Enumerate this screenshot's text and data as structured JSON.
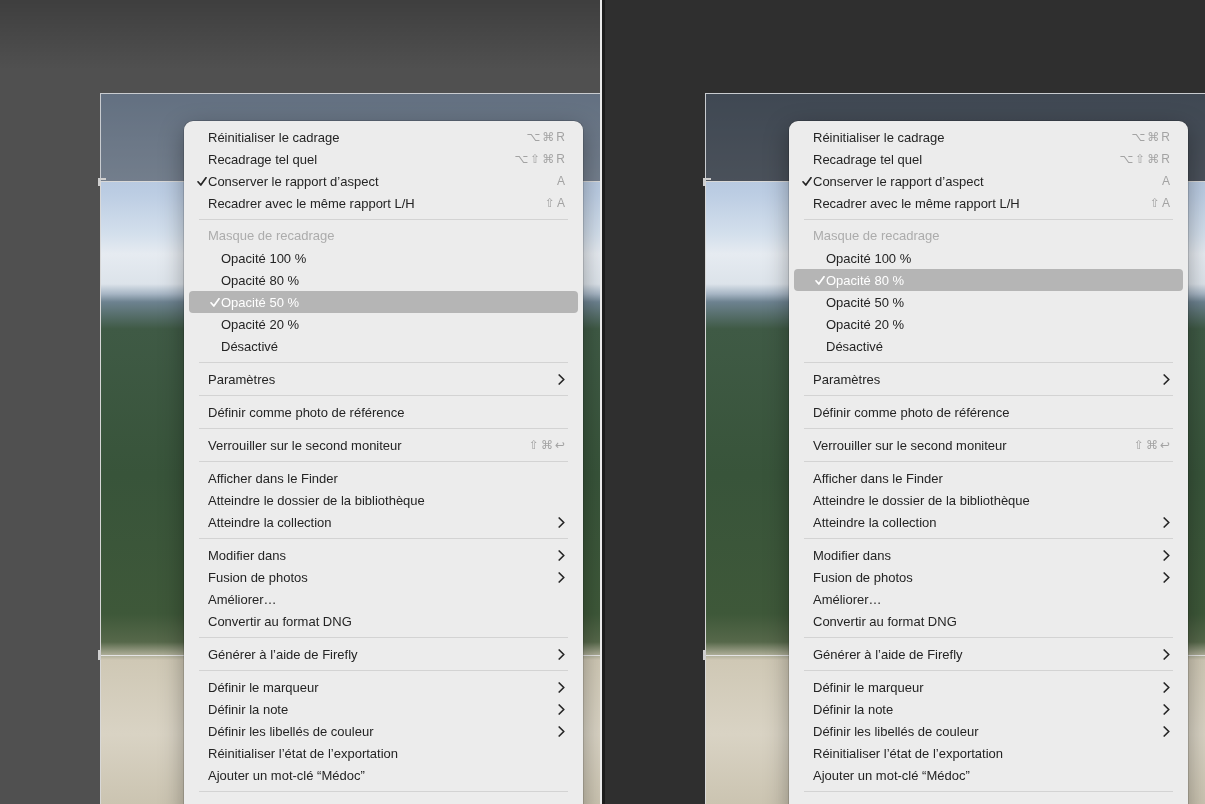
{
  "panels": [
    {
      "color": "#505050",
      "menu": {
        "sections": [
          {
            "items": [
              {
                "label": "Réinitialiser le cadrage",
                "shortcut": "⌥⌘R",
                "checked": false,
                "highlighted": false
              },
              {
                "label": "Recadrage tel quel",
                "shortcut": "⌥⇧⌘R",
                "checked": false,
                "highlighted": false
              },
              {
                "label": "Conserver le rapport d’aspect",
                "shortcut": "A",
                "checked": true,
                "highlighted": false
              },
              {
                "label": "Recadrer avec le même rapport L/H",
                "shortcut": "⇧A",
                "checked": false,
                "highlighted": false
              }
            ]
          },
          {
            "header": "Masque de recadrage",
            "items": [
              {
                "label": "Opacité 100 %",
                "selected": false,
                "highlighted": false
              },
              {
                "label": "Opacité 80 %",
                "selected": false,
                "highlighted": false
              },
              {
                "label": "Opacité 50 %",
                "selected": true,
                "highlighted": true
              },
              {
                "label": "Opacité 20 %",
                "selected": false,
                "highlighted": false
              },
              {
                "label": "Désactivé",
                "selected": false,
                "highlighted": false
              }
            ]
          },
          {
            "items": [
              {
                "label": "Paramètres",
                "submenu": true,
                "highlighted": false
              }
            ]
          },
          {
            "items": [
              {
                "label": "Définir comme photo de référence",
                "highlighted": false
              }
            ]
          },
          {
            "items": [
              {
                "label": "Verrouiller sur le second moniteur",
                "shortcut": "⇧⌘↩",
                "highlighted": false
              }
            ]
          },
          {
            "items": [
              {
                "label": "Afficher dans le Finder",
                "highlighted": false
              },
              {
                "label": "Atteindre le dossier de la bibliothèque",
                "highlighted": false
              },
              {
                "label": "Atteindre la collection",
                "submenu": true,
                "highlighted": false
              }
            ]
          },
          {
            "items": [
              {
                "label": "Modifier dans",
                "submenu": true,
                "highlighted": false
              },
              {
                "label": "Fusion de photos",
                "submenu": true,
                "highlighted": false
              },
              {
                "label": "Améliorer…",
                "highlighted": false
              },
              {
                "label": "Convertir au format DNG",
                "highlighted": false
              }
            ]
          },
          {
            "items": [
              {
                "label": "Générer à l’aide de Firefly",
                "submenu": true,
                "highlighted": false
              }
            ]
          },
          {
            "items": [
              {
                "label": "Définir le marqueur",
                "submenu": true,
                "highlighted": false
              },
              {
                "label": "Définir la note",
                "submenu": true,
                "highlighted": false
              },
              {
                "label": "Définir les libellés de couleur",
                "submenu": true,
                "highlighted": false
              },
              {
                "label": "Réinitialiser l’état de l’exportation",
                "highlighted": false
              },
              {
                "label": "Ajouter un mot-clé “Médoc”",
                "highlighted": false
              }
            ]
          }
        ]
      }
    },
    {
      "color": "#2f2f2f",
      "menu": {
        "sections": [
          {
            "items": [
              {
                "label": "Réinitialiser le cadrage",
                "shortcut": "⌥⌘R",
                "checked": false,
                "highlighted": false
              },
              {
                "label": "Recadrage tel quel",
                "shortcut": "⌥⇧⌘R",
                "checked": false,
                "highlighted": false
              },
              {
                "label": "Conserver le rapport d’aspect",
                "shortcut": "A",
                "checked": true,
                "highlighted": false
              },
              {
                "label": "Recadrer avec le même rapport L/H",
                "shortcut": "⇧A",
                "checked": false,
                "highlighted": false
              }
            ]
          },
          {
            "header": "Masque de recadrage",
            "items": [
              {
                "label": "Opacité 100 %",
                "selected": false,
                "highlighted": false
              },
              {
                "label": "Opacité 80 %",
                "selected": true,
                "highlighted": true
              },
              {
                "label": "Opacité 50 %",
                "selected": false,
                "highlighted": false
              },
              {
                "label": "Opacité 20 %",
                "selected": false,
                "highlighted": false
              },
              {
                "label": "Désactivé",
                "selected": false,
                "highlighted": false
              }
            ]
          },
          {
            "items": [
              {
                "label": "Paramètres",
                "submenu": true,
                "highlighted": false
              }
            ]
          },
          {
            "items": [
              {
                "label": "Définir comme photo de référence",
                "highlighted": false
              }
            ]
          },
          {
            "items": [
              {
                "label": "Verrouiller sur le second moniteur",
                "shortcut": "⇧⌘↩",
                "highlighted": false
              }
            ]
          },
          {
            "items": [
              {
                "label": "Afficher dans le Finder",
                "highlighted": false
              },
              {
                "label": "Atteindre le dossier de la bibliothèque",
                "highlighted": false
              },
              {
                "label": "Atteindre la collection",
                "submenu": true,
                "highlighted": false
              }
            ]
          },
          {
            "items": [
              {
                "label": "Modifier dans",
                "submenu": true,
                "highlighted": false
              },
              {
                "label": "Fusion de photos",
                "submenu": true,
                "highlighted": false
              },
              {
                "label": "Améliorer…",
                "highlighted": false
              },
              {
                "label": "Convertir au format DNG",
                "highlighted": false
              }
            ]
          },
          {
            "items": [
              {
                "label": "Générer à l’aide de Firefly",
                "submenu": true,
                "highlighted": false
              }
            ]
          },
          {
            "items": [
              {
                "label": "Définir le marqueur",
                "submenu": true,
                "highlighted": false
              },
              {
                "label": "Définir la note",
                "submenu": true,
                "highlighted": false
              },
              {
                "label": "Définir les libellés de couleur",
                "submenu": true,
                "highlighted": false
              },
              {
                "label": "Réinitialiser l’état de l’exportation",
                "highlighted": false
              },
              {
                "label": "Ajouter un mot-clé “Médoc”",
                "highlighted": false
              }
            ]
          }
        ]
      }
    }
  ]
}
